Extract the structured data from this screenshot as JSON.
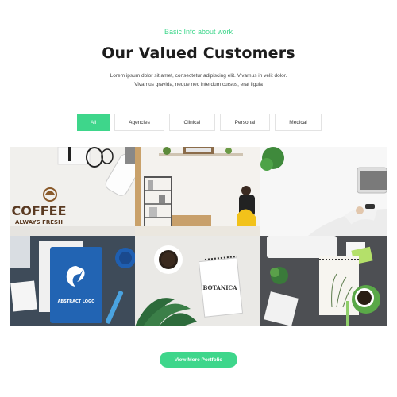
{
  "section": {
    "eyebrow": "Basic Info about work",
    "title": "Our Valued Customers",
    "description_line1": "Lorem ipsum dolor sit amet, consectetur adipiscing elit. Vivamus in velit dolor.",
    "description_line2": "Vivamus gravida, neque nec interdum cursus, erat ligula"
  },
  "filters": [
    {
      "label": "All",
      "active": true
    },
    {
      "label": "Agencies",
      "active": false
    },
    {
      "label": "Clinical",
      "active": false
    },
    {
      "label": "Personal",
      "active": false
    },
    {
      "label": "Medical",
      "active": false
    }
  ],
  "portfolio": {
    "items": [
      {
        "name": "coffee-branding",
        "coffee_text": "COFFEE",
        "tagline": "ALWAYS FRESH"
      },
      {
        "name": "office-workspace"
      },
      {
        "name": "laptop-desk"
      },
      {
        "name": "abstract-logo-notebook",
        "logo_text": "ABSTRACT LOGO"
      },
      {
        "name": "botanica-notebook",
        "brand_text": "BOTANICA"
      },
      {
        "name": "botanical-sketchbook"
      }
    ]
  },
  "cta": {
    "label": "View More Portfolio"
  },
  "colors": {
    "accent": "#3ed68b"
  }
}
